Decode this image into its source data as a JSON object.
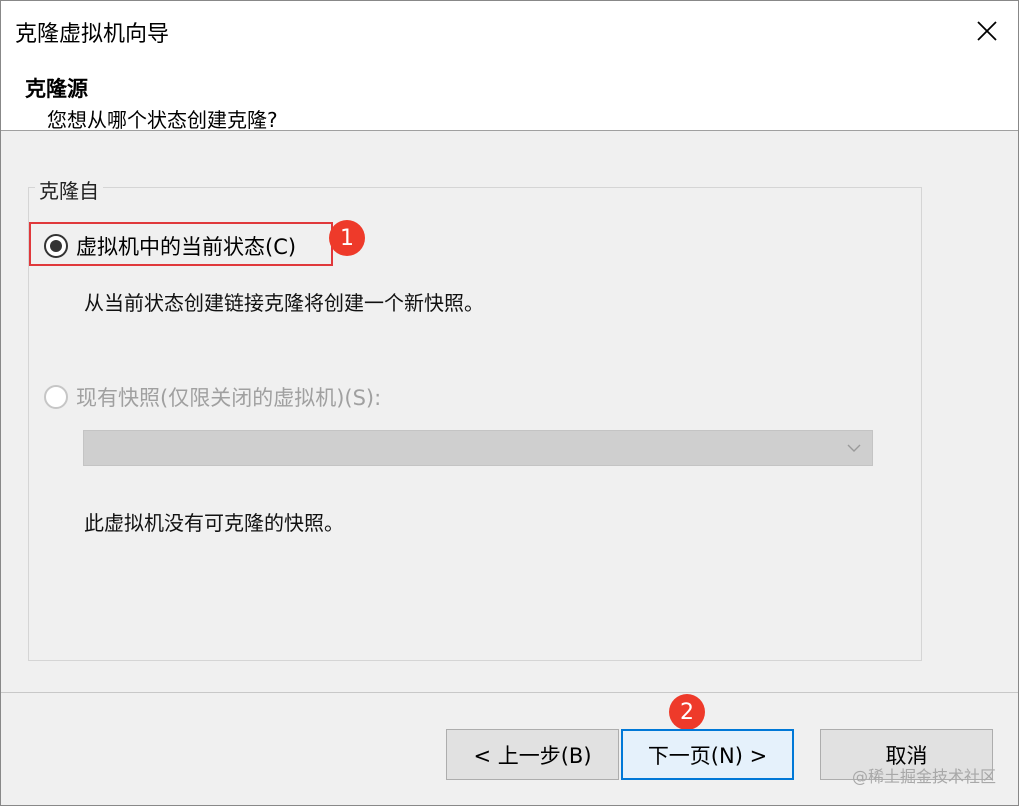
{
  "window": {
    "title": "克隆虚拟机向导",
    "close_icon": "close-icon"
  },
  "header": {
    "title": "克隆源",
    "subtitle": "您想从哪个状态创建克隆?"
  },
  "group": {
    "label": "克隆自",
    "option_current": {
      "label": "虚拟机中的当前状态(C)",
      "selected": true,
      "description": "从当前状态创建链接克隆将创建一个新快照。"
    },
    "option_snapshot": {
      "label": "现有快照(仅限关闭的虚拟机)(S):",
      "selected": false,
      "disabled": true,
      "description": "此虚拟机没有可克隆的快照。"
    },
    "snapshot_dropdown": {
      "value": "",
      "disabled": true
    }
  },
  "annotations": {
    "badge1": "1",
    "badge2": "2",
    "highlight_color": "#e0383b",
    "badge_color": "#ee3a2a"
  },
  "footer": {
    "back_label": "< 上一步(B)",
    "next_label": "下一页(N) >",
    "cancel_label": "取消"
  },
  "watermark": "@稀土掘金技术社区"
}
